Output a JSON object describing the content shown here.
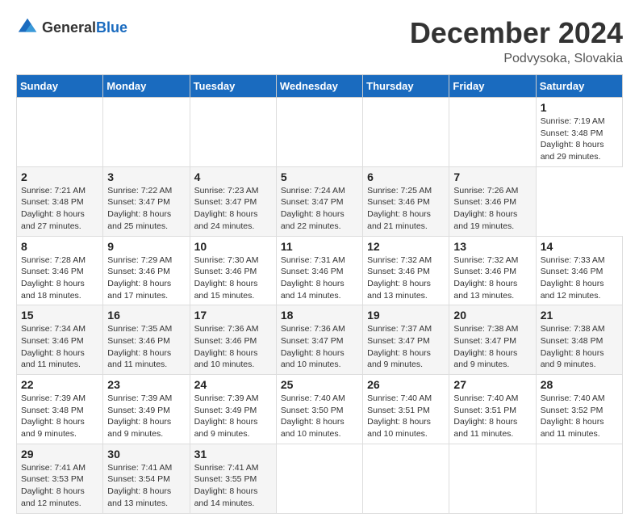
{
  "header": {
    "logo": {
      "general": "General",
      "blue": "Blue"
    },
    "title": "December 2024",
    "location": "Podvysoka, Slovakia"
  },
  "calendar": {
    "days_of_week": [
      "Sunday",
      "Monday",
      "Tuesday",
      "Wednesday",
      "Thursday",
      "Friday",
      "Saturday"
    ],
    "weeks": [
      [
        null,
        null,
        null,
        null,
        null,
        null,
        {
          "day": "1",
          "sunrise": "Sunrise: 7:19 AM",
          "sunset": "Sunset: 3:48 PM",
          "daylight": "Daylight: 8 hours and 29 minutes."
        }
      ],
      [
        {
          "day": "2",
          "sunrise": "Sunrise: 7:21 AM",
          "sunset": "Sunset: 3:48 PM",
          "daylight": "Daylight: 8 hours and 27 minutes."
        },
        {
          "day": "3",
          "sunrise": "Sunrise: 7:22 AM",
          "sunset": "Sunset: 3:47 PM",
          "daylight": "Daylight: 8 hours and 25 minutes."
        },
        {
          "day": "4",
          "sunrise": "Sunrise: 7:23 AM",
          "sunset": "Sunset: 3:47 PM",
          "daylight": "Daylight: 8 hours and 24 minutes."
        },
        {
          "day": "5",
          "sunrise": "Sunrise: 7:24 AM",
          "sunset": "Sunset: 3:47 PM",
          "daylight": "Daylight: 8 hours and 22 minutes."
        },
        {
          "day": "6",
          "sunrise": "Sunrise: 7:25 AM",
          "sunset": "Sunset: 3:46 PM",
          "daylight": "Daylight: 8 hours and 21 minutes."
        },
        {
          "day": "7",
          "sunrise": "Sunrise: 7:26 AM",
          "sunset": "Sunset: 3:46 PM",
          "daylight": "Daylight: 8 hours and 19 minutes."
        }
      ],
      [
        {
          "day": "8",
          "sunrise": "Sunrise: 7:28 AM",
          "sunset": "Sunset: 3:46 PM",
          "daylight": "Daylight: 8 hours and 18 minutes."
        },
        {
          "day": "9",
          "sunrise": "Sunrise: 7:29 AM",
          "sunset": "Sunset: 3:46 PM",
          "daylight": "Daylight: 8 hours and 17 minutes."
        },
        {
          "day": "10",
          "sunrise": "Sunrise: 7:30 AM",
          "sunset": "Sunset: 3:46 PM",
          "daylight": "Daylight: 8 hours and 15 minutes."
        },
        {
          "day": "11",
          "sunrise": "Sunrise: 7:31 AM",
          "sunset": "Sunset: 3:46 PM",
          "daylight": "Daylight: 8 hours and 14 minutes."
        },
        {
          "day": "12",
          "sunrise": "Sunrise: 7:32 AM",
          "sunset": "Sunset: 3:46 PM",
          "daylight": "Daylight: 8 hours and 13 minutes."
        },
        {
          "day": "13",
          "sunrise": "Sunrise: 7:32 AM",
          "sunset": "Sunset: 3:46 PM",
          "daylight": "Daylight: 8 hours and 13 minutes."
        },
        {
          "day": "14",
          "sunrise": "Sunrise: 7:33 AM",
          "sunset": "Sunset: 3:46 PM",
          "daylight": "Daylight: 8 hours and 12 minutes."
        }
      ],
      [
        {
          "day": "15",
          "sunrise": "Sunrise: 7:34 AM",
          "sunset": "Sunset: 3:46 PM",
          "daylight": "Daylight: 8 hours and 11 minutes."
        },
        {
          "day": "16",
          "sunrise": "Sunrise: 7:35 AM",
          "sunset": "Sunset: 3:46 PM",
          "daylight": "Daylight: 8 hours and 11 minutes."
        },
        {
          "day": "17",
          "sunrise": "Sunrise: 7:36 AM",
          "sunset": "Sunset: 3:46 PM",
          "daylight": "Daylight: 8 hours and 10 minutes."
        },
        {
          "day": "18",
          "sunrise": "Sunrise: 7:36 AM",
          "sunset": "Sunset: 3:47 PM",
          "daylight": "Daylight: 8 hours and 10 minutes."
        },
        {
          "day": "19",
          "sunrise": "Sunrise: 7:37 AM",
          "sunset": "Sunset: 3:47 PM",
          "daylight": "Daylight: 8 hours and 9 minutes."
        },
        {
          "day": "20",
          "sunrise": "Sunrise: 7:38 AM",
          "sunset": "Sunset: 3:47 PM",
          "daylight": "Daylight: 8 hours and 9 minutes."
        },
        {
          "day": "21",
          "sunrise": "Sunrise: 7:38 AM",
          "sunset": "Sunset: 3:48 PM",
          "daylight": "Daylight: 8 hours and 9 minutes."
        }
      ],
      [
        {
          "day": "22",
          "sunrise": "Sunrise: 7:39 AM",
          "sunset": "Sunset: 3:48 PM",
          "daylight": "Daylight: 8 hours and 9 minutes."
        },
        {
          "day": "23",
          "sunrise": "Sunrise: 7:39 AM",
          "sunset": "Sunset: 3:49 PM",
          "daylight": "Daylight: 8 hours and 9 minutes."
        },
        {
          "day": "24",
          "sunrise": "Sunrise: 7:39 AM",
          "sunset": "Sunset: 3:49 PM",
          "daylight": "Daylight: 8 hours and 9 minutes."
        },
        {
          "day": "25",
          "sunrise": "Sunrise: 7:40 AM",
          "sunset": "Sunset: 3:50 PM",
          "daylight": "Daylight: 8 hours and 10 minutes."
        },
        {
          "day": "26",
          "sunrise": "Sunrise: 7:40 AM",
          "sunset": "Sunset: 3:51 PM",
          "daylight": "Daylight: 8 hours and 10 minutes."
        },
        {
          "day": "27",
          "sunrise": "Sunrise: 7:40 AM",
          "sunset": "Sunset: 3:51 PM",
          "daylight": "Daylight: 8 hours and 11 minutes."
        },
        {
          "day": "28",
          "sunrise": "Sunrise: 7:40 AM",
          "sunset": "Sunset: 3:52 PM",
          "daylight": "Daylight: 8 hours and 11 minutes."
        }
      ],
      [
        {
          "day": "29",
          "sunrise": "Sunrise: 7:41 AM",
          "sunset": "Sunset: 3:53 PM",
          "daylight": "Daylight: 8 hours and 12 minutes."
        },
        {
          "day": "30",
          "sunrise": "Sunrise: 7:41 AM",
          "sunset": "Sunset: 3:54 PM",
          "daylight": "Daylight: 8 hours and 13 minutes."
        },
        {
          "day": "31",
          "sunrise": "Sunrise: 7:41 AM",
          "sunset": "Sunset: 3:55 PM",
          "daylight": "Daylight: 8 hours and 14 minutes."
        },
        null,
        null,
        null,
        null
      ]
    ]
  }
}
